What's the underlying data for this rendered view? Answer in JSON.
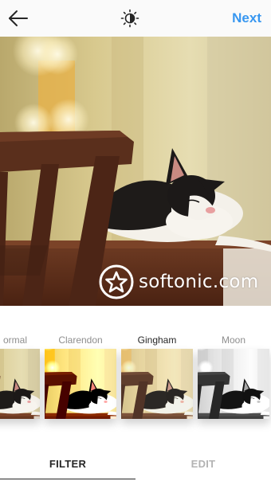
{
  "header": {
    "back_icon": "arrow-left-icon",
    "lux_icon": "lux-sun-icon",
    "next_label": "Next",
    "accent_color": "#3897f0"
  },
  "photo": {
    "subject": "cat-photo"
  },
  "watermark": {
    "text": "softonic.com",
    "logo_icon": "softonic-logo-icon"
  },
  "filters": [
    {
      "label": "ormal",
      "selected": false
    },
    {
      "label": "Clarendon",
      "selected": false
    },
    {
      "label": "Gingham",
      "selected": true
    },
    {
      "label": "Moon",
      "selected": false
    }
  ],
  "tabs": {
    "filter_label": "FILTER",
    "edit_label": "EDIT",
    "active": "filter"
  }
}
